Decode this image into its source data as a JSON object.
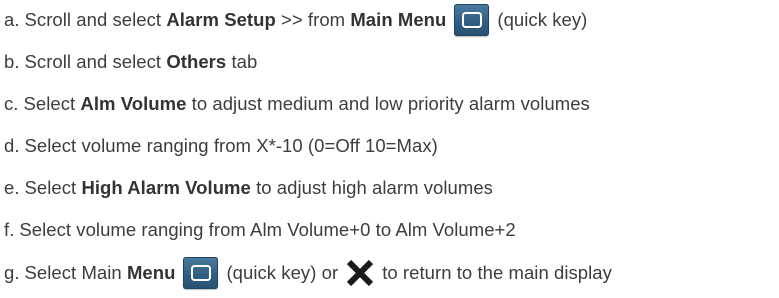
{
  "steps": [
    {
      "letter": "a.",
      "parts": {
        "t1": "Scroll and select ",
        "b1": "Alarm Setup",
        "t2": " >> from ",
        "b2": "Main Menu",
        "t3": "(quick key)"
      }
    },
    {
      "letter": "b.",
      "parts": {
        "t1": "Scroll and select ",
        "b1": "Others",
        "t2": " tab"
      }
    },
    {
      "letter": "c.",
      "parts": {
        "t1": "Select ",
        "b1": "Alm Volume",
        "t2": " to adjust medium and low priority alarm volumes"
      }
    },
    {
      "letter": "d.",
      "parts": {
        "t1": "Select volume ranging from X*-10 (0=Off 10=Max)"
      }
    },
    {
      "letter": "e.",
      "parts": {
        "t1": "Select ",
        "b1": "High Alarm Volume",
        "t2": " to adjust high alarm volumes"
      }
    },
    {
      "letter": "f.",
      "parts": {
        "t1": "Select volume ranging from Alm Volume+0 to Alm Volume+2"
      }
    },
    {
      "letter": "g.",
      "parts": {
        "t1": "Select Main ",
        "b1": "Menu",
        "t2": "(quick key) or",
        "t3": "to return to the main display"
      }
    }
  ],
  "icons": {
    "menu_key": "menu-key-icon",
    "close": "close-x-icon",
    "menu_key_color": "#305f83",
    "close_color": "#1a1a1a"
  }
}
